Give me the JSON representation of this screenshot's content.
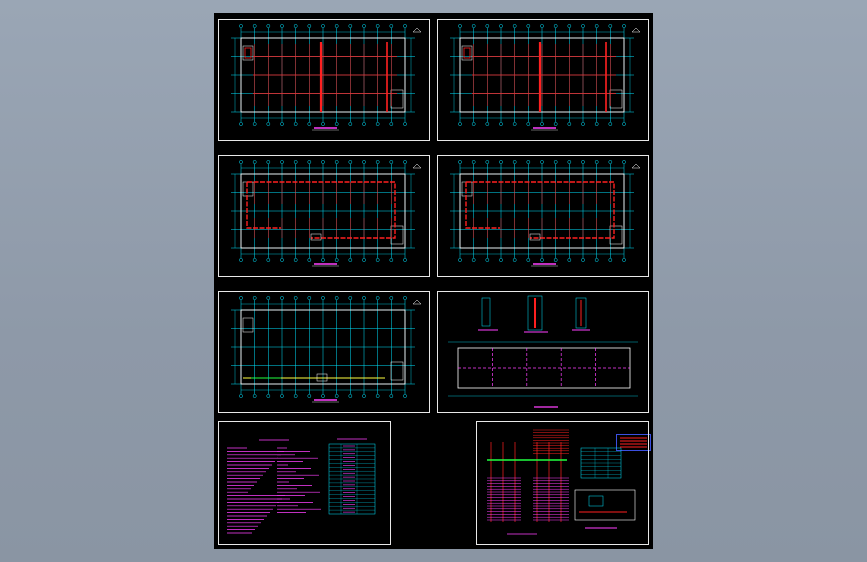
{
  "viewer": {
    "background_color": "#949fae",
    "sheet_color": "#000000"
  },
  "drawing_panels": [
    {
      "id": "panel-1",
      "kind": "floor-plan-red-piping"
    },
    {
      "id": "panel-2",
      "kind": "floor-plan-red-piping"
    },
    {
      "id": "panel-3",
      "kind": "floor-plan-red-loop"
    },
    {
      "id": "panel-4",
      "kind": "floor-plan-red-loop"
    },
    {
      "id": "panel-5",
      "kind": "floor-plan-grid"
    },
    {
      "id": "panel-6",
      "kind": "plan-with-details"
    },
    {
      "id": "panel-7",
      "kind": "notes-and-legend-table"
    },
    {
      "id": "panel-8",
      "kind": "system-diagram"
    }
  ],
  "colors": {
    "grid": "#00e5ff",
    "pipe": "#ff2020",
    "text": "#ff40ff",
    "frame": "#e8e8e8",
    "wall": "#ffffff",
    "accent_blue": "#3b4fe0",
    "green": "#20ff40",
    "yellow": "#ffff40"
  }
}
